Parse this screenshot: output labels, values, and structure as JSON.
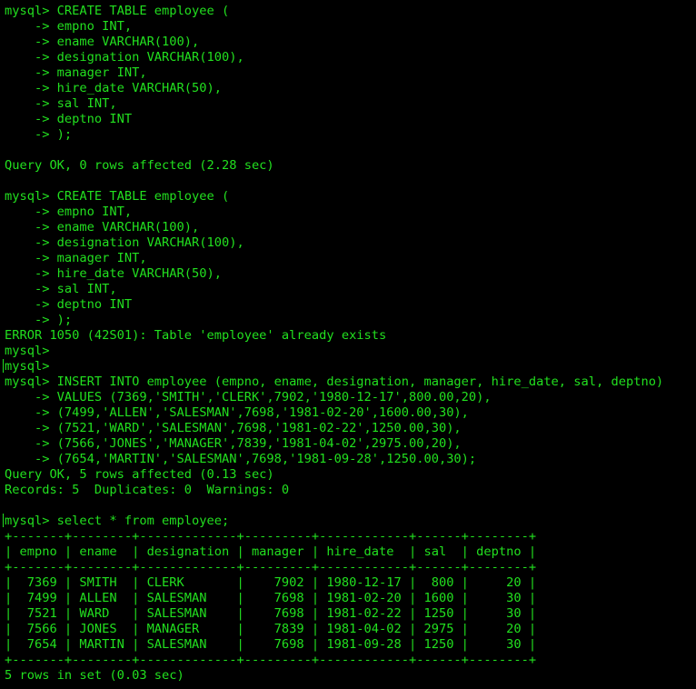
{
  "terminal": {
    "prompt": "mysql>",
    "lines": [
      "mysql> CREATE TABLE employee (",
      "    -> empno INT,",
      "    -> ename VARCHAR(100),",
      "    -> designation VARCHAR(100),",
      "    -> manager INT,",
      "    -> hire_date VARCHAR(50),",
      "    -> sal INT,",
      "    -> deptno INT",
      "    -> );",
      "",
      "Query OK, 0 rows affected (2.28 sec)",
      "",
      "mysql> CREATE TABLE employee (",
      "    -> empno INT,",
      "    -> ename VARCHAR(100),",
      "    -> designation VARCHAR(100),",
      "    -> manager INT,",
      "    -> hire_date VARCHAR(50),",
      "    -> sal INT,",
      "    -> deptno INT",
      "    -> );",
      "ERROR 1050 (42S01): Table 'employee' already exists",
      "mysql>",
      "mysql>",
      "mysql> INSERT INTO employee (empno, ename, designation, manager, hire_date, sal, deptno)",
      "    -> VALUES (7369,'SMITH','CLERK',7902,'1980-12-17',800.00,20),",
      "    -> (7499,'ALLEN','SALESMAN',7698,'1981-02-20',1600.00,30),",
      "    -> (7521,'WARD','SALESMAN',7698,'1981-02-22',1250.00,30),",
      "    -> (7566,'JONES','MANAGER',7839,'1981-04-02',2975.00,20),",
      "    -> (7654,'MARTIN','SALESMAN',7698,'1981-09-28',1250.00,30);",
      "Query OK, 5 rows affected (0.13 sec)",
      "Records: 5  Duplicates: 0  Warnings: 0",
      "",
      "mysql> select * from employee;",
      "+-------+--------+-------------+---------+------------+------+--------+",
      "| empno | ename  | designation | manager | hire_date  | sal  | deptno |",
      "+-------+--------+-------------+---------+------------+------+--------+",
      "|  7369 | SMITH  | CLERK       |    7902 | 1980-12-17 |  800 |     20 |",
      "|  7499 | ALLEN  | SALESMAN    |    7698 | 1981-02-20 | 1600 |     30 |",
      "|  7521 | WARD   | SALESMAN    |    7698 | 1981-02-22 | 1250 |     30 |",
      "|  7566 | JONES  | MANAGER     |    7839 | 1981-04-02 | 2975 |     20 |",
      "|  7654 | MARTIN | SALESMAN    |    7698 | 1981-09-28 | 1250 |     30 |",
      "+-------+--------+-------------+---------+------------+------+--------+",
      "5 rows in set (0.03 sec)"
    ]
  },
  "colors": {
    "background": "#000000",
    "text": "#22e01f"
  }
}
